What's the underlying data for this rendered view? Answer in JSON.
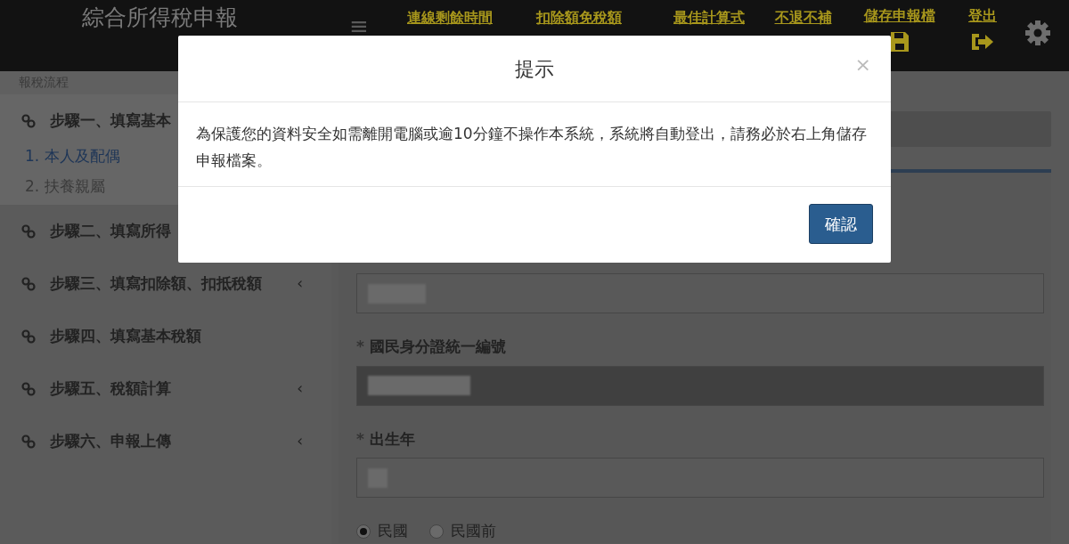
{
  "header": {
    "title": "綜合所得稅申報",
    "menu_icon": "≡",
    "nav": [
      {
        "label": "連線剩餘時間",
        "kind": "text"
      },
      {
        "label": "扣除額免稅額",
        "kind": "text"
      },
      {
        "label": "最佳計算式",
        "kind": "text"
      },
      {
        "label": "不退不補",
        "kind": "text"
      },
      {
        "label": "儲存申報檔",
        "kind": "save"
      },
      {
        "label": "登出",
        "kind": "logout"
      }
    ]
  },
  "sidebar": {
    "heading": "報稅流程",
    "steps": [
      {
        "label": "步驟一、填寫基本",
        "children": [
          {
            "label": "1. 本人及配偶",
            "selected": true
          },
          {
            "label": "2. 扶養親屬",
            "selected": false
          }
        ]
      },
      {
        "label": "步驟二、填寫所得"
      },
      {
        "label": "步驟三、填寫扣除額、扣抵稅額",
        "caret": "‹"
      },
      {
        "label": "步驟四、填寫基本稅額"
      },
      {
        "label": "步驟五、稅額計算",
        "caret": "‹"
      },
      {
        "label": "步驟六、申報上傳",
        "caret": "‹"
      }
    ]
  },
  "form": {
    "fields": [
      {
        "masked": true,
        "disabled": false
      },
      {
        "required_mark": "*",
        "label": "國民身分證統一編號",
        "masked": true,
        "disabled": true
      },
      {
        "required_mark": "*",
        "label": "出生年",
        "masked": true,
        "disabled": false
      }
    ],
    "radios": [
      {
        "label": "民國",
        "selected": true
      },
      {
        "label": "民國前",
        "selected": false
      }
    ]
  },
  "modal": {
    "title": "提示",
    "close": "×",
    "message": "為保護您的資料安全如需離開電腦或逾10分鐘不操作本系統，系統將自動登出，請務必於右上角儲存申報檔案。",
    "button": "確認"
  }
}
